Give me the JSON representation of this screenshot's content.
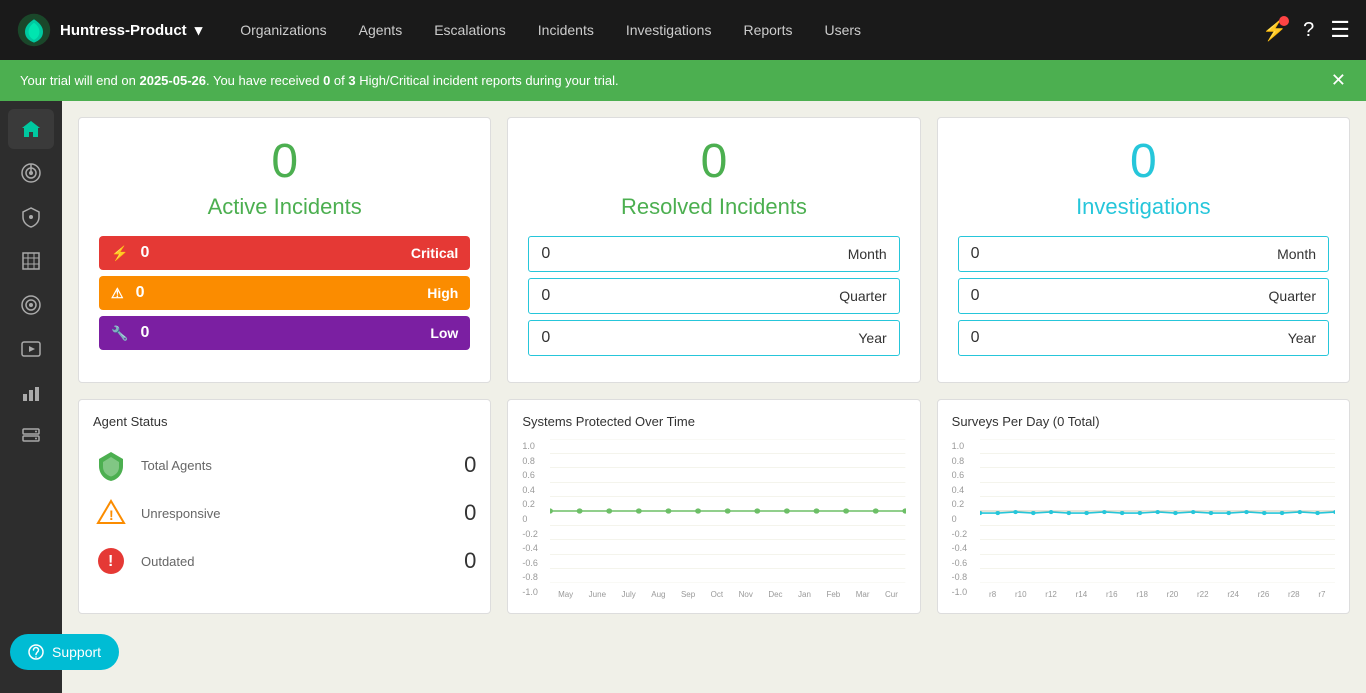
{
  "navbar": {
    "brand": "Huntress-Product",
    "dropdown_icon": "▾",
    "links": [
      "Organizations",
      "Agents",
      "Escalations",
      "Incidents",
      "Investigations",
      "Reports",
      "Users"
    ]
  },
  "alert": {
    "text_before": "Your trial will end on ",
    "date": "2025-05-26",
    "text_after": ". You have received ",
    "count": "0",
    "total": "3",
    "text_end": " High/Critical incident reports during your trial."
  },
  "sidebar": {
    "items": [
      {
        "name": "home",
        "icon": "⌂"
      },
      {
        "name": "radar",
        "icon": "◎"
      },
      {
        "name": "shield",
        "icon": "⛨"
      },
      {
        "name": "cage",
        "icon": "▦"
      },
      {
        "name": "target",
        "icon": "◉"
      },
      {
        "name": "media",
        "icon": "▶"
      },
      {
        "name": "chart",
        "icon": "▮"
      },
      {
        "name": "server",
        "icon": "▤"
      }
    ]
  },
  "active_incidents": {
    "title": "Active Incidents",
    "count": "0",
    "badges": [
      {
        "type": "critical",
        "count": "0",
        "label": "Critical",
        "icon": "⚡"
      },
      {
        "type": "high",
        "count": "0",
        "label": "High",
        "icon": "⚠"
      },
      {
        "type": "low",
        "count": "0",
        "label": "Low",
        "icon": "🔧"
      }
    ]
  },
  "resolved_incidents": {
    "title": "Resolved Incidents",
    "count": "0",
    "metrics": [
      {
        "value": "0",
        "label": "Month"
      },
      {
        "value": "0",
        "label": "Quarter"
      },
      {
        "value": "0",
        "label": "Year"
      }
    ]
  },
  "investigations": {
    "title": "Investigations",
    "count": "0",
    "metrics": [
      {
        "value": "0",
        "label": "Month"
      },
      {
        "value": "0",
        "label": "Quarter"
      },
      {
        "value": "0",
        "label": "Year"
      }
    ]
  },
  "agent_status": {
    "title": "Agent Status",
    "items": [
      {
        "label": "Total Agents",
        "value": "0",
        "icon_color": "#4caf50",
        "icon_type": "shield"
      },
      {
        "label": "Unresponsive",
        "value": "0",
        "icon_color": "#fb8c00",
        "icon_type": "warning"
      },
      {
        "label": "Outdated",
        "value": "0",
        "icon_color": "#e53935",
        "icon_type": "error"
      }
    ]
  },
  "systems_chart": {
    "title": "Systems Protected Over Time",
    "y_labels": [
      "1.0",
      "0.8",
      "0.6",
      "0.4",
      "0.2",
      "0",
      "-0.2",
      "-0.4",
      "-0.6",
      "-0.8",
      "-1.0"
    ],
    "x_labels": [
      "May",
      "June",
      "July",
      "August",
      "September",
      "October",
      "November",
      "December",
      "January",
      "February",
      "March",
      "Current"
    ]
  },
  "surveys_chart": {
    "title": "Surveys Per Day (0 Total)",
    "y_labels": [
      "1.0",
      "0.8",
      "0.6",
      "0.4",
      "0.2",
      "0",
      "-0.2",
      "-0.4",
      "-0.6",
      "-0.8",
      "-1.0"
    ],
    "x_labels": [
      "r8",
      "r10",
      "r12",
      "r14",
      "r16",
      "r18",
      "r20",
      "r22",
      "r24",
      "r26",
      "r28",
      "r7"
    ]
  },
  "support": {
    "label": "Support"
  }
}
